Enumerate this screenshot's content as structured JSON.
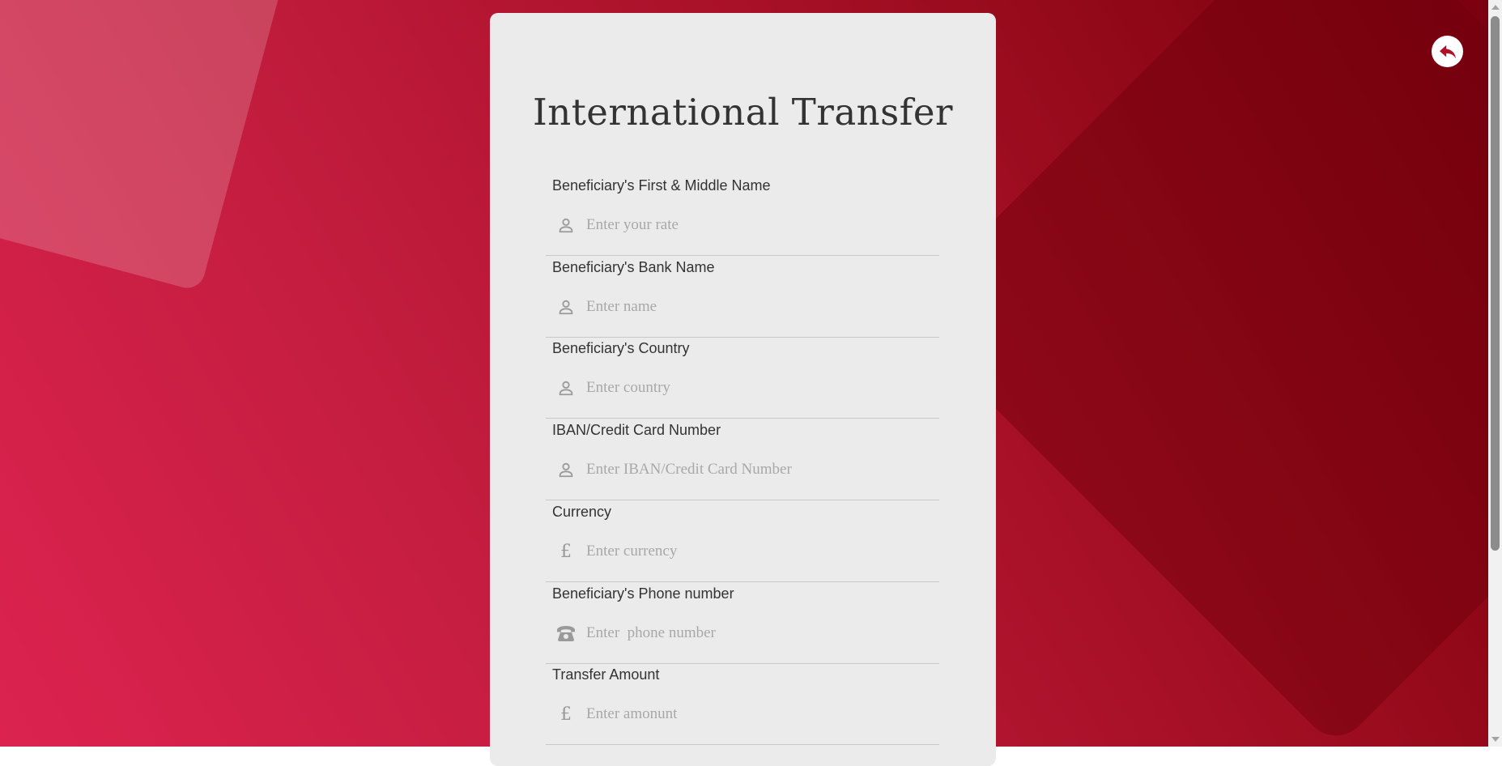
{
  "form": {
    "title": "International Transfer",
    "fields": [
      {
        "label": "Beneficiary's First & Middle Name",
        "placeholder": "Enter your rate",
        "icon": "user-icon"
      },
      {
        "label": "Beneficiary's Bank Name",
        "placeholder": "Enter name",
        "icon": "user-icon"
      },
      {
        "label": "Beneficiary's Country",
        "placeholder": "Enter country",
        "icon": "user-icon"
      },
      {
        "label": "IBAN/Credit Card Number",
        "placeholder": "Enter IBAN/Credit Card Number",
        "icon": "user-icon"
      },
      {
        "label": "Currency",
        "placeholder": "Enter currency",
        "icon": "pound-icon",
        "icon_glyph": "£"
      },
      {
        "label": "Beneficiary's Phone number",
        "placeholder": "Enter  phone number",
        "icon": "phone-icon"
      },
      {
        "label": "Transfer Amount",
        "placeholder": "Enter amonunt",
        "icon": "pound-icon",
        "icon_glyph": "£"
      }
    ]
  },
  "nav": {
    "back_icon": "reply-arrow-icon"
  },
  "colors": {
    "background_light": "#dc2350",
    "background_dark": "#7a0010",
    "card": "#ebebeb",
    "back_icon": "#b0102a"
  }
}
